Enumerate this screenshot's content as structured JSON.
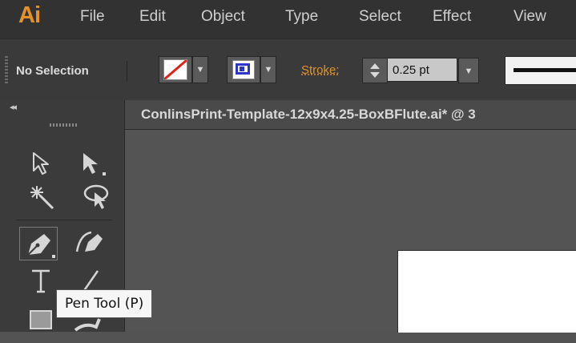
{
  "app": {
    "logo": "Ai"
  },
  "menu": [
    "File",
    "Edit",
    "Object",
    "Type",
    "Select",
    "Effect",
    "View"
  ],
  "control_bar": {
    "selection_status": "No Selection",
    "stroke_label": "Stroke:",
    "stroke_weight": "0.25 pt"
  },
  "document": {
    "tab_title": "ConlinsPrint-Template-12x9x4.25-BoxBFlute.ai* @ 3"
  },
  "tools_panel": {
    "collapse_glyph": "◂◂",
    "tools": [
      "selection-tool",
      "direct-selection-tool",
      "magic-wand-tool",
      "lasso-tool",
      "pen-tool",
      "curvature-tool",
      "type-tool",
      "line-segment-tool",
      "rectangle-tool",
      "paintbrush-tool"
    ],
    "active_tool": "pen-tool"
  },
  "tooltip": {
    "text": "Pen Tool (P)"
  },
  "colors": {
    "accent": "#e3922a",
    "stroke_blue": "#2d36c7",
    "fill_none_red": "#e0211b"
  }
}
